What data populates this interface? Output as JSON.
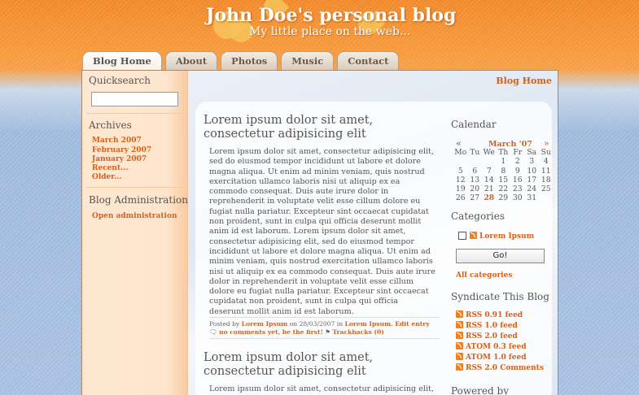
{
  "header": {
    "title": "John Doe's personal blog",
    "subtitle": "My little place on the web..."
  },
  "tabs": [
    {
      "label": "Blog Home",
      "active": true
    },
    {
      "label": "About",
      "active": false
    },
    {
      "label": "Photos",
      "active": false
    },
    {
      "label": "Music",
      "active": false
    },
    {
      "label": "Contact",
      "active": false
    }
  ],
  "breadcrumb": "Blog Home",
  "left_sidebar": {
    "quicksearch_heading": "Quicksearch",
    "quicksearch_value": "",
    "archives_heading": "Archives",
    "archives": [
      "March 2007",
      "February 2007",
      "January 2007",
      "Recent...",
      "Older..."
    ],
    "admin_heading": "Blog Administration",
    "admin_link": "Open administration"
  },
  "posts": [
    {
      "title": "Lorem ipsum dolor sit amet, consectetur adipisicing elit",
      "body": "Lorem ipsum dolor sit amet, consectetur adipisicing elit, sed do eiusmod tempor incididunt ut labore et dolore magna aliqua. Ut enim ad minim veniam, quis nostrud exercitation ullamco laboris nisi ut aliquip ex ea commodo consequat. Duis aute irure dolor in reprehenderit in voluptate velit esse cillum dolore eu fugiat nulla pariatur. Excepteur sint occaecat cupidatat non proident, sunt in culpa qui officia deserunt mollit anim id est laborum. Lorem ipsum dolor sit amet, consectetur adipisicing elit, sed do eiusmod tempor incididunt ut labore et dolore magna aliqua. Ut enim ad minim veniam, quis nostrud exercitation ullamco laboris nisi ut aliquip ex ea commodo consequat. Duis aute irure dolor in reprehenderit in voluptate velit esse cillum dolore eu fugiat nulla pariatur. Excepteur sint occaecat cupidatat non proident, sunt in culpa qui officia deserunt mollit anim id est laborum.",
      "meta_posted_by": "Posted by",
      "meta_author": "Lorem Ipsum",
      "meta_on": "on 28/03/2007 in",
      "meta_category": "Lorem Ipsum.",
      "meta_edit": "Edit entry",
      "meta_comments": "no comments yet, be the first!",
      "meta_trackbacks": "Trackbacks (0)"
    },
    {
      "title": "Lorem ipsum dolor sit amet, consectetur adipisicing elit",
      "body": "Lorem ipsum dolor sit amet, consectetur adipisicing elit, sed do"
    }
  ],
  "right_sidebar": {
    "calendar_heading": "Calendar",
    "calendar_prev": "«",
    "calendar_next": "»",
    "calendar_month": "March '07",
    "calendar_days": [
      "Mo",
      "Tu",
      "We",
      "Th",
      "Fr",
      "Sa",
      "Su"
    ],
    "calendar_cells": [
      "",
      "",
      "",
      "1",
      "2",
      "3",
      "4",
      "5",
      "6",
      "7",
      "8",
      "9",
      "10",
      "11",
      "12",
      "13",
      "14",
      "15",
      "16",
      "17",
      "18",
      "19",
      "20",
      "21",
      "22",
      "23",
      "24",
      "25",
      "26",
      "27",
      "28",
      "29",
      "30",
      "31",
      ""
    ],
    "calendar_highlight": "28",
    "categories_heading": "Categories",
    "category_item": "Lorem Ipsum",
    "go_button": "Go!",
    "all_categories": "All categories",
    "syndicate_heading": "Syndicate This Blog",
    "feeds": [
      "RSS 0.91 feed",
      "RSS 1.0 feed",
      "RSS 2.0 feed",
      "ATOM 0.3 feed",
      "ATOM 1.0 feed",
      "RSS 2.0 Comments"
    ],
    "powered_heading": "Powered by"
  }
}
